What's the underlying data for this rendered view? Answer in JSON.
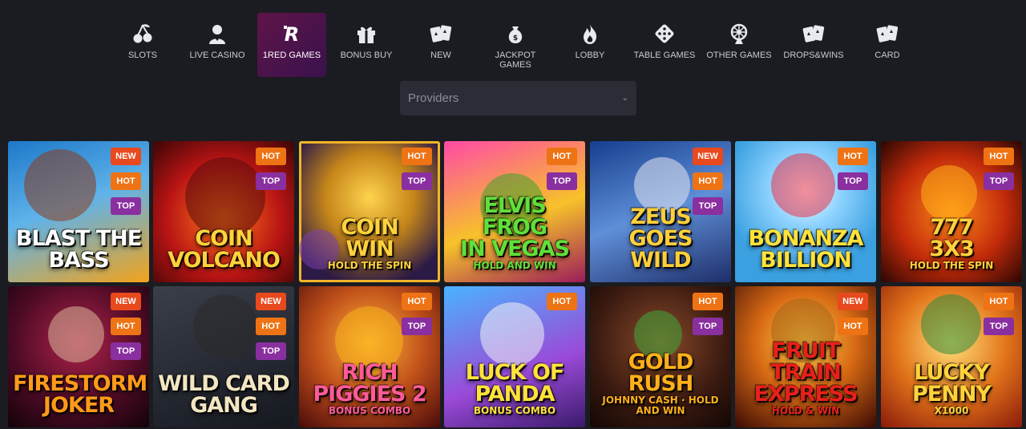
{
  "nav": [
    {
      "label": "SLOTS",
      "icon": "cherries-icon",
      "name": "nav-slots"
    },
    {
      "label": "LIVE CASINO",
      "icon": "dealer-icon",
      "name": "nav-live-casino"
    },
    {
      "label": "1RED GAMES",
      "icon": "1red-logo-icon",
      "name": "nav-1red-games",
      "active": true
    },
    {
      "label": "BONUS BUY",
      "icon": "gift-icon",
      "name": "nav-bonus-buy"
    },
    {
      "label": "NEW",
      "icon": "cards-icon",
      "name": "nav-new"
    },
    {
      "label": "JACKPOT\nGAMES",
      "icon": "money-bag-icon",
      "name": "nav-jackpot-games"
    },
    {
      "label": "LOBBY",
      "icon": "flame-icon",
      "name": "nav-lobby"
    },
    {
      "label": "TABLE GAMES",
      "icon": "dice-icon",
      "name": "nav-table-games"
    },
    {
      "label": "OTHER GAMES",
      "icon": "roulette-icon",
      "name": "nav-other-games"
    },
    {
      "label": "DROPS&WINS",
      "icon": "cards-icon",
      "name": "nav-drops-wins"
    },
    {
      "label": "CARD",
      "icon": "cards-icon",
      "name": "nav-card"
    }
  ],
  "providers": {
    "placeholder": "Providers"
  },
  "colors": {
    "background": "#1b1c21",
    "badge_new": "#e8491d",
    "badge_hot": "#ee7314",
    "badge_top": "#8a2fa0",
    "active_tab": "#5e1448"
  },
  "games": [
    {
      "title": "BLAST THE\nBASS",
      "sub": "",
      "badges": [
        "NEW",
        "HOT",
        "TOP"
      ]
    },
    {
      "title": "COIN\nVOLCANO",
      "sub": "",
      "badges": [
        "HOT",
        "TOP"
      ]
    },
    {
      "title": "COIN\nWIN",
      "sub": "HOLD THE SPIN",
      "badges": [
        "HOT",
        "TOP"
      ]
    },
    {
      "title": "ELVIS FROG\nIN VEGAS",
      "sub": "HOLD AND WIN",
      "badges": [
        "HOT",
        "TOP"
      ]
    },
    {
      "title": "ZEUS\nGOES\nWILD",
      "sub": "",
      "badges": [
        "NEW",
        "HOT",
        "TOP"
      ]
    },
    {
      "title": "BONANZA\nBILLION",
      "sub": "",
      "badges": [
        "HOT",
        "TOP"
      ]
    },
    {
      "title": "777\n3X3",
      "sub": "HOLD THE SPIN",
      "badges": [
        "HOT",
        "TOP"
      ]
    },
    {
      "title": "FIRESTORM\nJOKER",
      "sub": "",
      "badges": [
        "NEW",
        "HOT",
        "TOP"
      ]
    },
    {
      "title": "WILD CARD\nGANG",
      "sub": "",
      "badges": [
        "NEW",
        "HOT",
        "TOP"
      ]
    },
    {
      "title": "RICH\nPIGGIES 2",
      "sub": "BONUS COMBO",
      "badges": [
        "HOT",
        "TOP"
      ]
    },
    {
      "title": "LUCK OF\nPANDA",
      "sub": "BONUS COMBO",
      "badges": [
        "HOT"
      ]
    },
    {
      "title": "GOLD RUSH",
      "sub": "JOHNNY CASH · HOLD AND WIN",
      "badges": [
        "HOT",
        "TOP"
      ]
    },
    {
      "title": "FRUIT TRAIN\nEXPRESS",
      "sub": "HOLD & WIN",
      "badges": [
        "NEW",
        "HOT"
      ]
    },
    {
      "title": "LUCKY\nPENNY",
      "sub": "X1000",
      "badges": [
        "HOT",
        "TOP"
      ]
    }
  ]
}
